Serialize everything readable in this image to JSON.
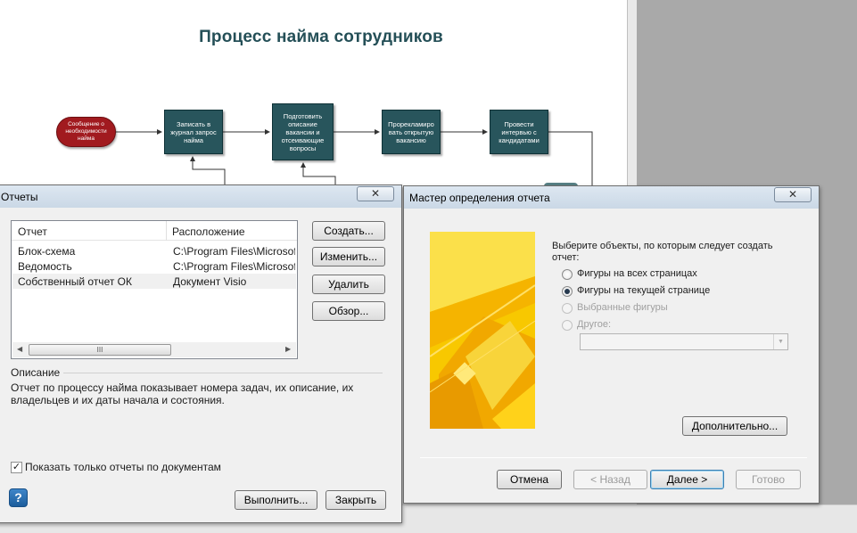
{
  "diagram": {
    "title": "Процесс найма сотрудников",
    "start_label": "Сообщение о необходимости найма",
    "steps": [
      "Записать в журнал запрос найма",
      "Подготовить описание вакансии и отсеивающие вопросы",
      "Прорекламиро вать открытую вакансию",
      "Провести интервью с кандидатами"
    ]
  },
  "reports_dialog": {
    "title": "Отчеты",
    "close_glyph": "✕",
    "columns": [
      "Отчет",
      "Расположение"
    ],
    "rows": [
      {
        "name": "Блок-схема",
        "location": "C:\\Program Files\\Microsoft"
      },
      {
        "name": "Ведомость",
        "location": "C:\\Program Files\\Microsoft"
      },
      {
        "name": "Собственный отчет ОК",
        "location": "Документ Visio"
      }
    ],
    "scroll_thumb_glyph": "III",
    "buttons": {
      "create": "Создать...",
      "edit": "Изменить...",
      "delete": "Удалить",
      "browse": "Обзор..."
    },
    "description_label": "Описание",
    "description_text": "Отчет по процессу найма показывает номера задач, их описание, их владельцев и их даты начала и состояния.",
    "docs_only_label": "Показать только отчеты по документам",
    "docs_only_checked": true,
    "help_glyph": "?",
    "run_label": "Выполнить...",
    "close_label": "Закрыть"
  },
  "wizard_dialog": {
    "title": "Мастер определения отчета",
    "close_glyph": "✕",
    "prompt": "Выберите объекты, по которым следует создать отчет:",
    "options": [
      {
        "label": "Фигуры на всех страницах",
        "checked": false,
        "enabled": true
      },
      {
        "label": "Фигуры на текущей странице",
        "checked": true,
        "enabled": true
      },
      {
        "label": "Выбранные фигуры",
        "checked": false,
        "enabled": false
      },
      {
        "label": "Другое:",
        "checked": false,
        "enabled": false
      }
    ],
    "other_value": "",
    "advanced_label": "Дополнительно...",
    "cancel_label": "Отмена",
    "back_label": "< Назад",
    "next_label": "Далее >",
    "finish_label": "Готово"
  },
  "colors": {
    "process_box": "#28555c",
    "start_oval": "#a11a1f",
    "title_text": "#244f57",
    "wizard_art": "#f7c400"
  }
}
